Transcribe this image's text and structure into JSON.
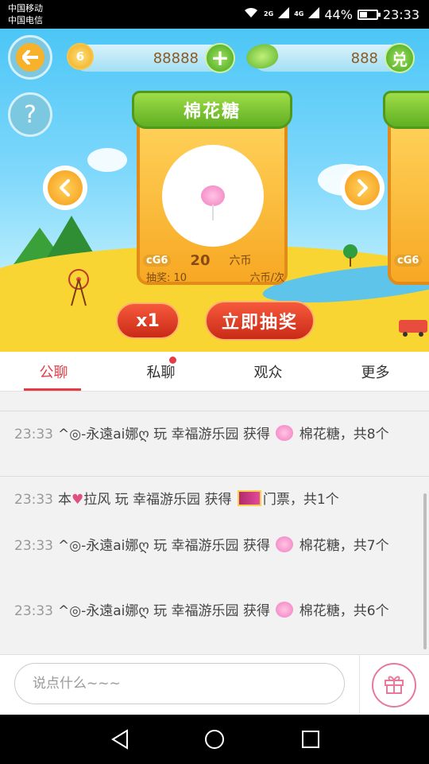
{
  "status_bar": {
    "carrier1": "中国移动",
    "carrier2": "中国电信",
    "battery": "44%",
    "battery_level": 0.44,
    "time": "23:33",
    "network": [
      "2G",
      "4G",
      "2G"
    ]
  },
  "game": {
    "coins": "88888",
    "coin_badge": "6",
    "beans": "888",
    "exchange_label": "兑",
    "plus_label": "+",
    "prize": {
      "name": "棉花糖",
      "badge": "cG6",
      "price": "20",
      "currency": "六币",
      "draw_label": "抽奖: 10",
      "draw_unit": "六币/次"
    },
    "next_card_badge": "cG6",
    "multiplier": "x1",
    "draw_button": "立即抽奖"
  },
  "tabs": [
    {
      "label": "公聊",
      "active": true
    },
    {
      "label": "私聊",
      "badge": true
    },
    {
      "label": "观众"
    },
    {
      "label": "更多"
    }
  ],
  "chat": {
    "messages": [
      {
        "time": "23:33",
        "user": "^◎-永遠ai娜ღ",
        "action": "玩 幸福游乐园 获得",
        "item": "棉花糖，共8个"
      },
      {
        "time": "23:33",
        "user": "本",
        "user_suffix": "拉风",
        "action": "玩 幸福游乐园 获得",
        "item": "门票，共1个"
      },
      {
        "time": "23:33",
        "user": "^◎-永遠ai娜ღ",
        "action": "玩 幸福游乐园 获得",
        "item": "棉花糖，共7个"
      },
      {
        "time": "23:33",
        "user": "^◎-永遠ai娜ღ",
        "action": "玩 幸福游乐园 获得",
        "item": "棉花糖，共6个"
      }
    ]
  },
  "input": {
    "placeholder": "说点什么~~~"
  },
  "icons": {
    "back": "back-arrow-icon",
    "help": "help-icon",
    "gift": "gift-icon"
  },
  "colors": {
    "accent": "#e33c47",
    "sky": "#4cc6f6",
    "ground": "#f9d533",
    "draw_button": "#d9331d"
  }
}
